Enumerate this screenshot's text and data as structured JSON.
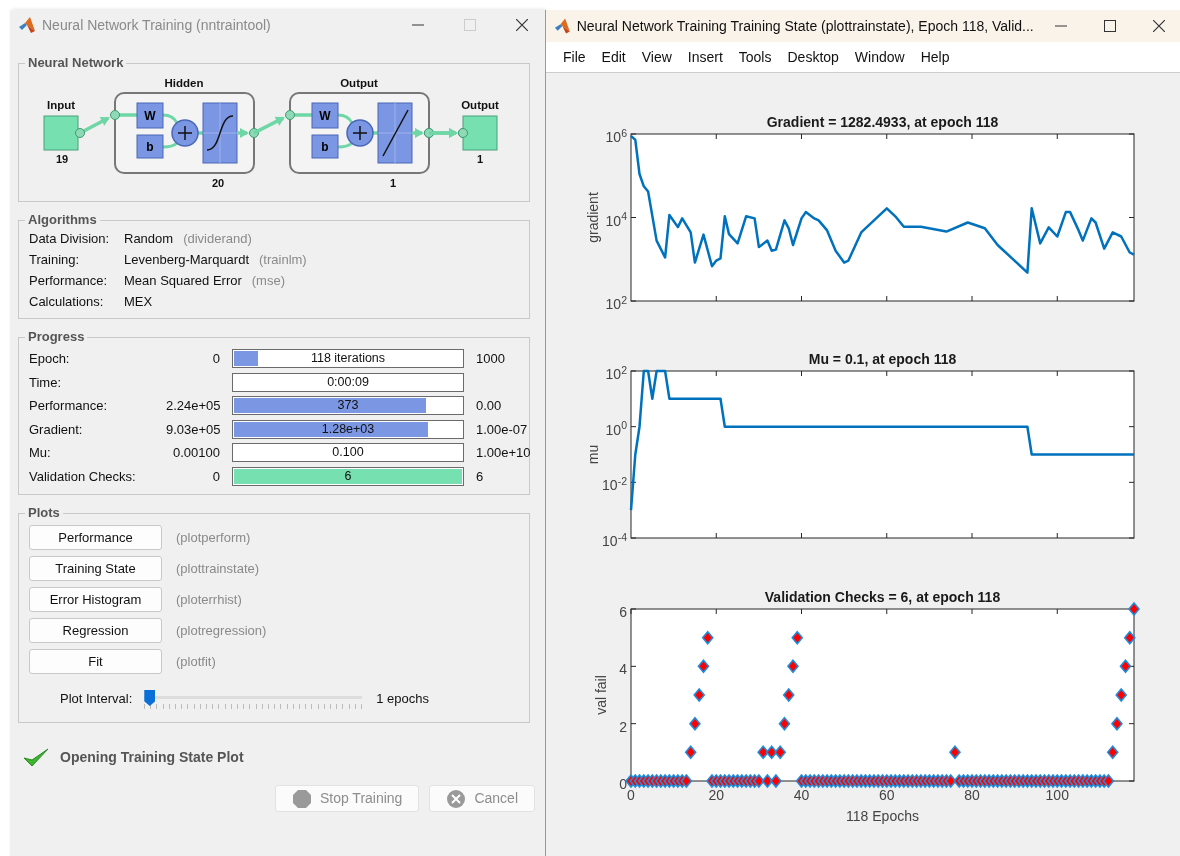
{
  "trainer_window": {
    "title": "Neural Network Training (nntraintool)",
    "network": {
      "heading": "Neural Network",
      "input": {
        "label": "Input",
        "size": "19"
      },
      "layers": [
        {
          "title": "Hidden",
          "weight": "W",
          "bias": "b",
          "kind": "sigmoid",
          "size": "20"
        },
        {
          "title": "Output",
          "weight": "W",
          "bias": "b",
          "kind": "linear",
          "size": "1"
        }
      ],
      "output": {
        "label": "Output",
        "size": "1"
      }
    },
    "algorithms": {
      "heading": "Algorithms",
      "rows": [
        {
          "label": "Data Division:",
          "value": "Random",
          "function": "(dividerand)"
        },
        {
          "label": "Training:",
          "value": "Levenberg-Marquardt",
          "function": "(trainlm)"
        },
        {
          "label": "Performance:",
          "value": "Mean Squared Error",
          "function": "(mse)"
        },
        {
          "label": "Calculations:",
          "value": "MEX"
        }
      ]
    },
    "progress": {
      "heading": "Progress",
      "rows": [
        {
          "label": "Epoch:",
          "start": "0",
          "bar_text": "118 iterations",
          "level": 0.115,
          "color": "#7b96e3",
          "end": "1000"
        },
        {
          "label": "Time:",
          "bar_text": "0:00:09"
        },
        {
          "label": "Performance:",
          "start": "2.24e+05",
          "bar_text": "373",
          "level": 0.845,
          "color": "#7b96e3",
          "end": "0.00"
        },
        {
          "label": "Gradient:",
          "start": "9.03e+05",
          "bar_text": "1.28e+03",
          "level": 0.85,
          "color": "#7b96e3",
          "end": "1.00e-07"
        },
        {
          "label": "Mu:",
          "start": "0.00100",
          "bar_text": "0.100",
          "end": "1.00e+10"
        },
        {
          "label": "Validation Checks:",
          "start": "0",
          "bar_text": "6",
          "level": 1,
          "color": "#76e0b0",
          "end": "6"
        }
      ]
    },
    "plots": {
      "heading": "Plots",
      "buttons": [
        {
          "label": "Performance",
          "function": "(plotperform)"
        },
        {
          "label": "Training State",
          "function": "(plottrainstate)"
        },
        {
          "label": "Error Histogram",
          "function": "(ploterrhist)"
        },
        {
          "label": "Regression",
          "function": "(plotregression)"
        },
        {
          "label": "Fit",
          "function": "(plotfit)"
        }
      ],
      "interval": {
        "label": "Plot Interval:",
        "level": 0,
        "reading": "1 epochs"
      }
    },
    "status": "Opening Training State Plot",
    "buttons": [
      {
        "label": "Stop Training",
        "kind": "stop",
        "disabled": true
      },
      {
        "label": "Cancel",
        "kind": "cancel",
        "disabled": true
      }
    ]
  },
  "plot_window": {
    "title": "Neural Network Training Training State (plottrainstate), Epoch 118, Valid...",
    "menu": [
      "File",
      "Edit",
      "View",
      "Insert",
      "Tools",
      "Desktop",
      "Window",
      "Help"
    ],
    "plots": [
      {
        "title": "Gradient = 1282.4933, at epoch 118",
        "ylabel": "gradient",
        "y_tick_labels": [
          "10$^{6}$",
          "10$^{4}$",
          "10$^{2}$"
        ]
      },
      {
        "title": "Mu = 0.1, at epoch 118",
        "ylabel": "mu",
        "y_tick_labels": [
          "10$^{2}$",
          "10$^{0}$",
          "10$^{-2}$",
          "10$^{-4}$"
        ]
      },
      {
        "chart_data": {
          "type": "scatter",
          "title": "Validation Checks = 6, at epoch 118",
          "xlabel": "118 Epochs",
          "ylabel": "val fail",
          "xlim": [
            0,
            118
          ],
          "ylim": [
            0,
            6
          ],
          "xticks": [
            0,
            20,
            40,
            60,
            80,
            100
          ],
          "yticks": [
            0,
            2,
            4,
            6
          ],
          "x": [
            0,
            1,
            2,
            3,
            4,
            5,
            6,
            7,
            8,
            9,
            10,
            11,
            12,
            13,
            14,
            15,
            16,
            17,
            18,
            19,
            20,
            21,
            22,
            23,
            24,
            25,
            26,
            27,
            28,
            29,
            30,
            31,
            32,
            33,
            34,
            35,
            36,
            37,
            38,
            39,
            40,
            41,
            42,
            43,
            44,
            45,
            46,
            47,
            48,
            49,
            50,
            51,
            52,
            53,
            54,
            55,
            56,
            57,
            58,
            59,
            60,
            61,
            62,
            63,
            64,
            65,
            66,
            67,
            68,
            69,
            70,
            71,
            72,
            73,
            74,
            75,
            76,
            77,
            78,
            79,
            80,
            81,
            82,
            83,
            84,
            85,
            86,
            87,
            88,
            89,
            90,
            91,
            92,
            93,
            94,
            95,
            96,
            97,
            98,
            99,
            100,
            101,
            102,
            103,
            104,
            105,
            106,
            107,
            108,
            109,
            110,
            111,
            112,
            113,
            114,
            115,
            116,
            117,
            118
          ],
          "series": [
            {
              "color": "#ff0000",
              "values": [
                0,
                0,
                0,
                0,
                0,
                0,
                0,
                0,
                0,
                0,
                0,
                0,
                0,
                0,
                1,
                2,
                3,
                4,
                5,
                0,
                0,
                0,
                0,
                0,
                0,
                0,
                0,
                0,
                0,
                0,
                0,
                1,
                0,
                1,
                0,
                1,
                2,
                3,
                4,
                5,
                0,
                0,
                0,
                0,
                0,
                0,
                0,
                0,
                0,
                0,
                0,
                0,
                0,
                0,
                0,
                0,
                0,
                0,
                0,
                0,
                0,
                0,
                0,
                0,
                0,
                0,
                0,
                0,
                0,
                0,
                0,
                0,
                0,
                0,
                0,
                0,
                1,
                0,
                0,
                0,
                0,
                0,
                0,
                0,
                0,
                0,
                0,
                0,
                0,
                0,
                0,
                0,
                0,
                0,
                0,
                0,
                0,
                0,
                0,
                0,
                0,
                0,
                0,
                0,
                0,
                0,
                0,
                0,
                0,
                0,
                0,
                0,
                0,
                1,
                2,
                3,
                4,
                5,
                6
              ]
            }
          ]
        }
      }
    ]
  }
}
